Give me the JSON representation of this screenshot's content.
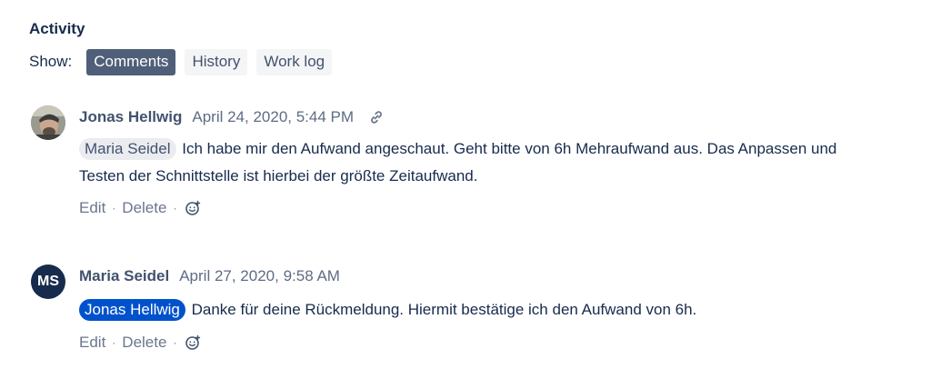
{
  "activity": {
    "title": "Activity",
    "show_label": "Show:",
    "filters": [
      "Comments",
      "History",
      "Work log"
    ],
    "active_filter": "Comments"
  },
  "comments": [
    {
      "author": "Jonas Hellwig",
      "timestamp": "April 24, 2020, 5:44 PM",
      "avatar": "photo",
      "mention": "Maria Seidel",
      "text_line1": "Ich habe mir den Aufwand angeschaut. Geht bitte von 6h Mehraufwand aus. Das Anpassen und",
      "text_line2": "Testen der Schnittstelle ist hierbei der größte Zeitaufwand.",
      "edit": "Edit",
      "delete": "Delete"
    },
    {
      "author": "Maria Seidel",
      "timestamp": "April 27, 2020, 9:58 AM",
      "avatar_initials": "MS",
      "mention": "Jonas Hellwig",
      "text": "Danke für deine Rückmeldung. Hiermit bestätige ich den Aufwand von 6h.",
      "edit": "Edit",
      "delete": "Delete"
    }
  ],
  "icons": {
    "link": "link-icon",
    "reaction": "add-reaction-icon"
  },
  "colors": {
    "active_filter_bg": "#505f79",
    "mention_self_bg": "#0052cc",
    "avatar_bg": "#172b4d"
  }
}
